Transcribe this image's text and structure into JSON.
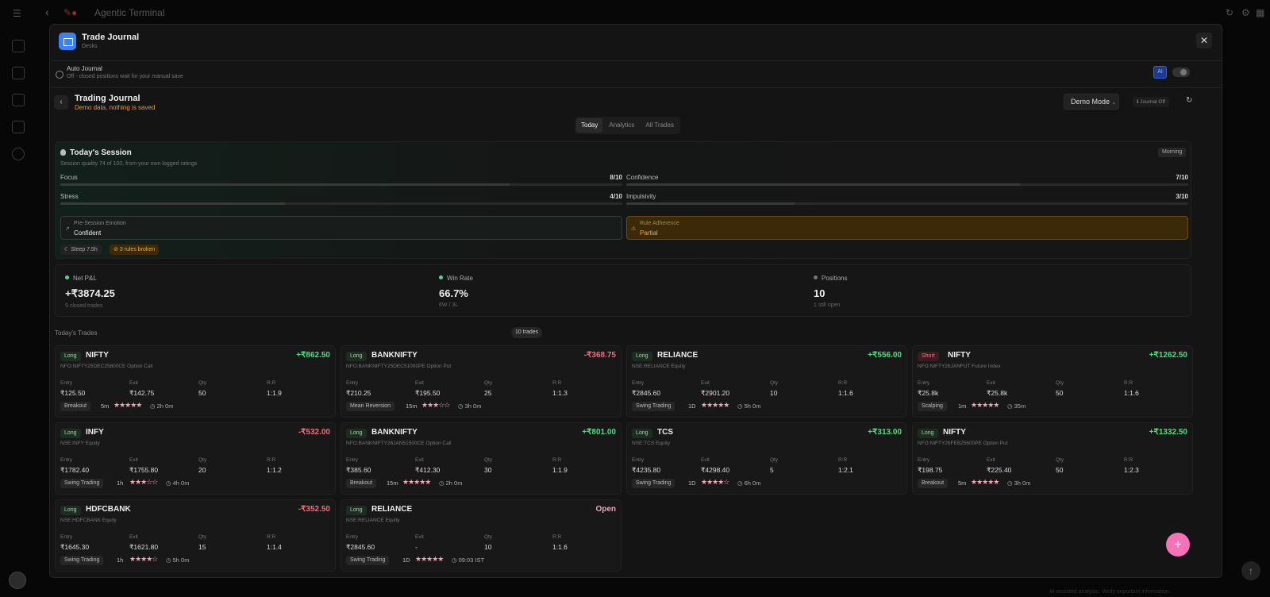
{
  "shell": {
    "app_title": "Agentic Terminal",
    "footnote": "AI-assisted analysis. Verify important information."
  },
  "modal": {
    "title": "Trade Journal",
    "subtitle": "Desks",
    "close": "✕"
  },
  "auto_journal": {
    "title": "Auto Journal",
    "subtitle": "Off - closed positions wait for your manual save",
    "badge": "AI"
  },
  "journal": {
    "title": "Trading Journal",
    "subtitle": "Demo data, nothing is saved",
    "mode_button": "Demo Mode",
    "journal_off": "Journal Off",
    "refresh": "↻"
  },
  "tabs": [
    {
      "label": "Today"
    },
    {
      "label": "Analytics"
    },
    {
      "label": "All Trades"
    }
  ],
  "session": {
    "title": "Today's Session",
    "subtitle": "Session quality 74 of 100, from your own logged ratings",
    "time_badge": "Morning",
    "metrics": [
      {
        "label": "Focus",
        "value": "8/10",
        "level": 0.8
      },
      {
        "label": "Confidence",
        "value": "7/10",
        "level": 0.7
      },
      {
        "label": "Stress",
        "value": "4/10",
        "level": 0.4
      },
      {
        "label": "Impulsivity",
        "value": "3/10",
        "level": 0.3
      }
    ],
    "emotion_label": "Pre-Session Emotion",
    "emotion_value": "Confident",
    "adherence_label": "Rule Adherence",
    "adherence_value": "Partial",
    "sleep_chip": "Sleep 7.5h",
    "rules_chip": "3 rules broken"
  },
  "stats": [
    {
      "label": "Net P&L",
      "value": "+₹3874.25",
      "sub": "9 closed trades",
      "dot_color": "#4ade80"
    },
    {
      "label": "Win Rate",
      "value": "66.7%",
      "sub": "6W / 3L",
      "dot_color": "#4ade80"
    },
    {
      "label": "Positions",
      "value": "10",
      "sub": "1 still open",
      "dot_color": "#777777"
    }
  ],
  "trades_header": "Today's Trades",
  "trades_count": "10 trades",
  "col_labels": {
    "entry": "Entry",
    "exit": "Exit",
    "qty": "Qty",
    "rr": "R:R"
  },
  "trades": [
    {
      "side": "Long",
      "symbol": "NIFTY",
      "pnl": "+₹862.50",
      "pnl_type": "pos",
      "instrument": "NFO:NIFTY25DEC25800CE  Option Call",
      "entry": "₹125.50",
      "exit": "₹142.75",
      "qty": "50",
      "rr": "1:1.9",
      "strategy": "Breakout",
      "timeframe": "5m",
      "stars": "★★★★★",
      "duration": "◷ 2h 0m"
    },
    {
      "side": "Long",
      "symbol": "BANKNIFTY",
      "pnl": "-₹368.75",
      "pnl_type": "neg",
      "instrument": "NFO:BANKNIFTY25DEC51000PE  Option Put",
      "entry": "₹210.25",
      "exit": "₹195.50",
      "qty": "25",
      "rr": "1:1.3",
      "strategy": "Mean Reversion",
      "timeframe": "15m",
      "stars": "★★★☆☆",
      "duration": "◷ 3h 0m"
    },
    {
      "side": "Long",
      "symbol": "RELIANCE",
      "pnl": "+₹556.00",
      "pnl_type": "pos",
      "instrument": "NSE:RELIANCE  Equity",
      "entry": "₹2845.60",
      "exit": "₹2901.20",
      "qty": "10",
      "rr": "1:1.6",
      "strategy": "Swing Trading",
      "timeframe": "1D",
      "stars": "★★★★★",
      "duration": "◷ 5h 0m"
    },
    {
      "side": "Short",
      "symbol": "NIFTY",
      "pnl": "+₹1262.50",
      "pnl_type": "pos",
      "instrument": "NFO:NIFTY26JANFUT  Future Index",
      "entry": "₹25.8k",
      "exit": "₹25.8k",
      "qty": "50",
      "rr": "1:1.6",
      "strategy": "Scalping",
      "timeframe": "1m",
      "stars": "★★★★★",
      "duration": "◷ 35m"
    },
    {
      "side": "Long",
      "symbol": "INFY",
      "pnl": "-₹532.00",
      "pnl_type": "neg",
      "instrument": "NSE:INFY  Equity",
      "entry": "₹1782.40",
      "exit": "₹1755.80",
      "qty": "20",
      "rr": "1:1.2",
      "strategy": "Swing Trading",
      "timeframe": "1h",
      "stars": "★★★☆☆",
      "duration": "◷ 4h 0m"
    },
    {
      "side": "Long",
      "symbol": "BANKNIFTY",
      "pnl": "+₹801.00",
      "pnl_type": "pos",
      "instrument": "NFO:BANKNIFTY26JAN51500CE  Option Call",
      "entry": "₹385.60",
      "exit": "₹412.30",
      "qty": "30",
      "rr": "1:1.9",
      "strategy": "Breakout",
      "timeframe": "15m",
      "stars": "★★★★★",
      "duration": "◷ 2h 0m"
    },
    {
      "side": "Long",
      "symbol": "TCS",
      "pnl": "+₹313.00",
      "pnl_type": "pos",
      "instrument": "NSE:TCS  Equity",
      "entry": "₹4235.80",
      "exit": "₹4298.40",
      "qty": "5",
      "rr": "1:2.1",
      "strategy": "Swing Trading",
      "timeframe": "1D",
      "stars": "★★★★☆",
      "duration": "◷ 6h 0m"
    },
    {
      "side": "Long",
      "symbol": "NIFTY",
      "pnl": "+₹1332.50",
      "pnl_type": "pos",
      "instrument": "NFO:NIFTY26FEB25600PE  Option Put",
      "entry": "₹198.75",
      "exit": "₹225.40",
      "qty": "50",
      "rr": "1:2.3",
      "strategy": "Breakout",
      "timeframe": "5m",
      "stars": "★★★★★",
      "duration": "◷ 3h 0m"
    },
    {
      "side": "Long",
      "symbol": "HDFCBANK",
      "pnl": "-₹352.50",
      "pnl_type": "neg",
      "instrument": "NSE:HDFCBANK  Equity",
      "entry": "₹1645.30",
      "exit": "₹1621.80",
      "qty": "15",
      "rr": "1:1.4",
      "strategy": "Swing Trading",
      "timeframe": "1h",
      "stars": "★★★★☆",
      "duration": "◷ 5h 0m"
    },
    {
      "side": "Long",
      "symbol": "RELIANCE",
      "pnl": "Open",
      "pnl_type": "open",
      "instrument": "NSE:RELIANCE  Equity",
      "entry": "₹2845.60",
      "exit": "-",
      "qty": "10",
      "rr": "1:1.6",
      "strategy": "Swing Trading",
      "timeframe": "1D",
      "stars": "★★★★★",
      "duration": "◷ 09:03 IST"
    }
  ],
  "fab": "+"
}
